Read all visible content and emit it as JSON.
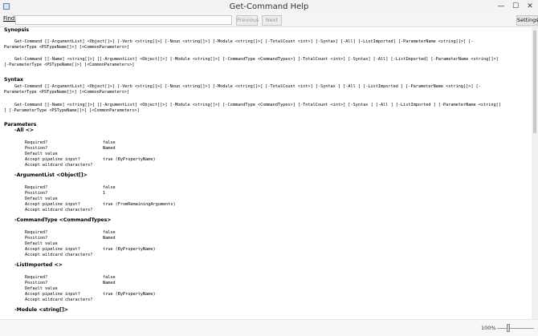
{
  "window": {
    "title": "Get-Command Help",
    "minimize_glyph": "—",
    "maximize_glyph": "☐",
    "close_glyph": "✕"
  },
  "toolbar": {
    "find_label": "Find:",
    "find_value": "",
    "previous_label": "Previous",
    "next_label": "Next",
    "settings_label": "Settings"
  },
  "help": {
    "synopsis_header": "Synopsis",
    "synopsis_1a": "Get-Command [[-ArgumentList] <Object[]>] [-Verb <string[]>] [-Noun <string[]>] [-Module <string[]>] [-TotalCount <int>] [-Syntax] [-All] [-ListImported] [-ParameterName <string[]>] [-",
    "synopsis_1b": "ParameterType <PSTypeName[]>] [<CommonParameters>]",
    "synopsis_2a": "Get-Command [[-Name] <string[]>] [[-ArgumentList] <Object[]>] [-Module <string[]>] [-CommandType <CommandTypes>] [-TotalCount <int>] [-Syntax] [-All] [-ListImported] [-ParameterName <string[]>]",
    "synopsis_2b": "[-ParameterType <PSTypeName[]>] [<CommonParameters>]",
    "syntax_header": "Syntax",
    "syntax_1a": "Get-Command [[-ArgumentList] <Object[]>] [-Verb <string[]>] [-Noun <string[]>] [-Module <string[]>] [-TotalCount <int>] [-Syntax ] [-All ] [-ListImported ] [-ParameterName <string[]>] [-",
    "syntax_1b": "ParameterType <PSTypeName[]>] [<CommonParameters>]",
    "syntax_2a": "Get-Command [[-Name] <string[]>] [[-ArgumentList] <Object[]>] [-Module <string[]>] [-CommandType <CommandTypes>] [-TotalCount <int>] [-Syntax ] [-All ] [-ListImported ] [-ParameterName <string[]",
    "syntax_2b": "] [-ParameterType <PSTypeName[]>] [<CommonParameters>]",
    "parameters_header": "Parameters",
    "field_required": "Required?",
    "field_position": "Position?",
    "field_default": "Default value",
    "field_pipeline": "Accept pipeline input?",
    "field_wildcard": "Accept wildcard characters?",
    "params": [
      {
        "name": "-All <>",
        "required": "false",
        "position": "Named",
        "default": "",
        "pipeline": "true (ByPropertyName)",
        "wildcard": ""
      },
      {
        "name": "-ArgumentList <Object[]>",
        "required": "false",
        "position": "1",
        "default": "",
        "pipeline": "true (FromRemainingArguments)",
        "wildcard": ""
      },
      {
        "name": "-CommandType <CommandTypes>",
        "required": "false",
        "position": "Named",
        "default": "",
        "pipeline": "true (ByPropertyName)",
        "wildcard": ""
      },
      {
        "name": "-ListImported <>",
        "required": "false",
        "position": "Named",
        "default": "",
        "pipeline": "true (ByPropertyName)",
        "wildcard": ""
      },
      {
        "name": "-Module <string[]>"
      }
    ]
  },
  "statusbar": {
    "zoom": "100%",
    "zoom_value_percent": 100
  }
}
